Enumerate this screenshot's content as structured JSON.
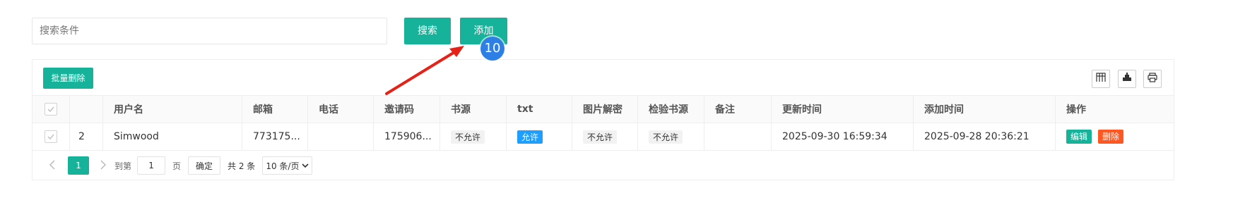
{
  "search": {
    "placeholder": "搜索条件",
    "search_label": "搜索",
    "add_label": "添加"
  },
  "annotation": {
    "badge": "10",
    "arrow_color": "#e62117",
    "badge_color": "#2d7fe6"
  },
  "toolbar": {
    "batch_delete_label": "批量删除",
    "icons": [
      "columns-icon",
      "export-icon",
      "print-icon"
    ]
  },
  "table": {
    "headers": [
      "",
      "",
      "用户名",
      "邮箱",
      "电话",
      "邀请码",
      "书源",
      "txt",
      "图片解密",
      "检验书源",
      "备注",
      "更新时间",
      "添加时间",
      "操作"
    ],
    "rows": [
      {
        "index": "2",
        "username": "Simwood",
        "email": "773175...",
        "phone": "",
        "invite_code": "175906...",
        "book_source": "不允许",
        "txt": "允许",
        "image_decrypt": "不允许",
        "verify_source": "不允许",
        "remark": "",
        "updated_at": "2025-09-30 16:59:34",
        "created_at": "2025-09-28 20:36:21",
        "edit_label": "编辑",
        "delete_label": "删除"
      }
    ]
  },
  "pager": {
    "prev": "<",
    "current": "1",
    "next": ">",
    "goto_label": "到第",
    "goto_value": "1",
    "page_label": "页",
    "confirm_label": "确定",
    "total_label": "共 2 条",
    "page_size": "10 条/页"
  },
  "colors": {
    "primary": "#16b39a",
    "allow": "#1e9fff",
    "danger": "#ff5722"
  }
}
